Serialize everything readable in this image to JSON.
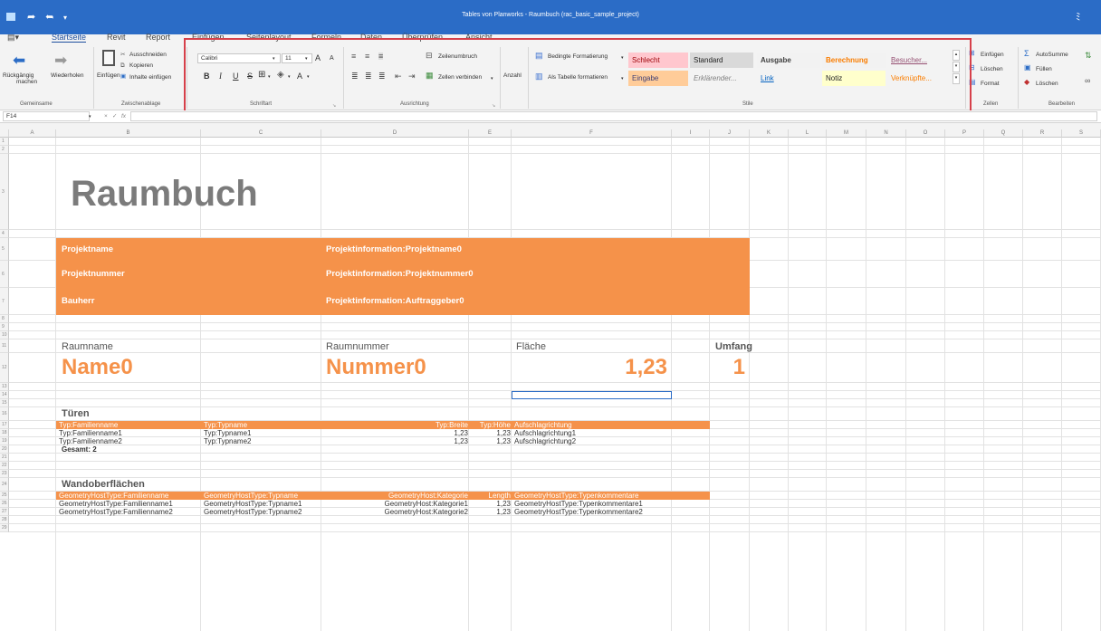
{
  "titlebar": {
    "title": "Tables von Planworks - Raumbuch  (rac_basic_sample_project)",
    "app_icon": "table-app-icon",
    "undo_icon": "undo-icon",
    "redo_icon": "redo-icon",
    "quick_access_chevron": "▾",
    "collapse_icon": "ﾐ"
  },
  "tabs": [
    "Startseite",
    "Revit",
    "Report",
    "Einfügen",
    "Seitenlayout",
    "Formeln",
    "Daten",
    "Überprüfen",
    "Ansicht"
  ],
  "ribbon": {
    "undo": "Rückgängig",
    "undo2": "machen",
    "redo": "Wiederholen",
    "group_undo": "Gemeinsame",
    "paste": "Einfügen",
    "cut": "Ausschneiden",
    "copy": "Kopieren",
    "paste_content": "Inhalte einfügen",
    "group_clip": "Zwischenablage",
    "font_name": "Calibri",
    "font_size": "11",
    "font_grow": "A",
    "font_shrink": "A",
    "bold": "B",
    "italic": "I",
    "underline": "U",
    "strike": "S",
    "font_color": "A",
    "group_font": "Schriftart",
    "wrap": "Zeilenumbruch",
    "merge": "Zellen verbinden",
    "group_align": "Ausrichtung",
    "number_format": "Anzahl",
    "cond_format": "Bedingte Formatierung",
    "as_table": "Als Tabelle formatieren",
    "group_styles": "Stile",
    "styles": {
      "schlecht": "Schlecht",
      "standard": "Standard",
      "ausgabe": "Ausgabe",
      "berechnung": "Berechnung",
      "besucher": "Besucher...",
      "eingabe": "Eingabe",
      "erklaerend": "Erklärender...",
      "link": "Link",
      "notiz": "Notiz",
      "verknuepfte": "Verknüpfte..."
    },
    "insert": "Einfügen",
    "delete": "Löschen",
    "format": "Format",
    "group_cells": "Zellen",
    "autosum": "AutoSumme",
    "fill": "Füllen",
    "clear": "Löschen",
    "group_edit": "Bearbeiten"
  },
  "formula_bar": {
    "name_box": "F14",
    "cancel": "×",
    "confirm": "✓",
    "fx": "fx",
    "value": ""
  },
  "columns": [
    "A",
    "B",
    "C",
    "D",
    "E",
    "F",
    "I",
    "J",
    "K",
    "L",
    "M",
    "N",
    "O",
    "P",
    "Q",
    "R",
    "S"
  ],
  "rows": [
    "1",
    "2",
    "3",
    "4",
    "5",
    "6",
    "7",
    "8",
    "9",
    "10",
    "11",
    "12",
    "13",
    "14",
    "15",
    "16",
    "17",
    "18",
    "19",
    "20",
    "21",
    "22",
    "23",
    "24",
    "25",
    "26",
    "27",
    "28",
    "29"
  ],
  "sheet": {
    "title": "Raumbuch",
    "projektname_label": "Projektname",
    "projektname_value": "Projektinformation:Projektname0",
    "projektnummer_label": "Projektnummer",
    "projektnummer_value": "Projektinformation:Projektnummer0",
    "bauherr_label": "Bauherr",
    "bauherr_value": "Projektinformation:Auftraggeber0",
    "raumname_label": "Raumname",
    "raumnummer_label": "Raumnummer",
    "flaeche_label": "Fläche",
    "umfang_label": "Umfang",
    "name_value": "Name0",
    "nummer_value": "Nummer0",
    "flaeche_value": "1,23",
    "umfang_value": "1",
    "tueren": {
      "title": "Türen",
      "headers": [
        "Typ:Familienname",
        "Typ:Typname",
        "Typ:Breite",
        "Typ:Höhe",
        "Aufschlagrichtung"
      ],
      "rows": [
        [
          "Typ:Familienname1",
          "Typ:Typname1",
          "1,23",
          "1,23",
          "Aufschlagrichtung1"
        ],
        [
          "Typ:Familienname2",
          "Typ:Typname2",
          "1,23",
          "1,23",
          "Aufschlagrichtung2"
        ]
      ],
      "total": "Gesamt: 2"
    },
    "wand": {
      "title": "Wandoberflächen",
      "headers": [
        "GeometryHostType:Familienname",
        "GeometryHostType:Typname",
        "GeometryHost:Kategorie",
        "Length",
        "GeometryHostType:Typenkommentare"
      ],
      "rows": [
        [
          "GeometryHostType:Familienname1",
          "GeometryHostType:Typname1",
          "GeometryHost:Kategorie1",
          "1,23",
          "GeometryHostType:Typenkommentare1"
        ],
        [
          "GeometryHostType:Familienname2",
          "GeometryHostType:Typname2",
          "GeometryHost:Kategorie2",
          "1,23",
          "GeometryHostType:Typenkommentare2"
        ]
      ]
    }
  }
}
